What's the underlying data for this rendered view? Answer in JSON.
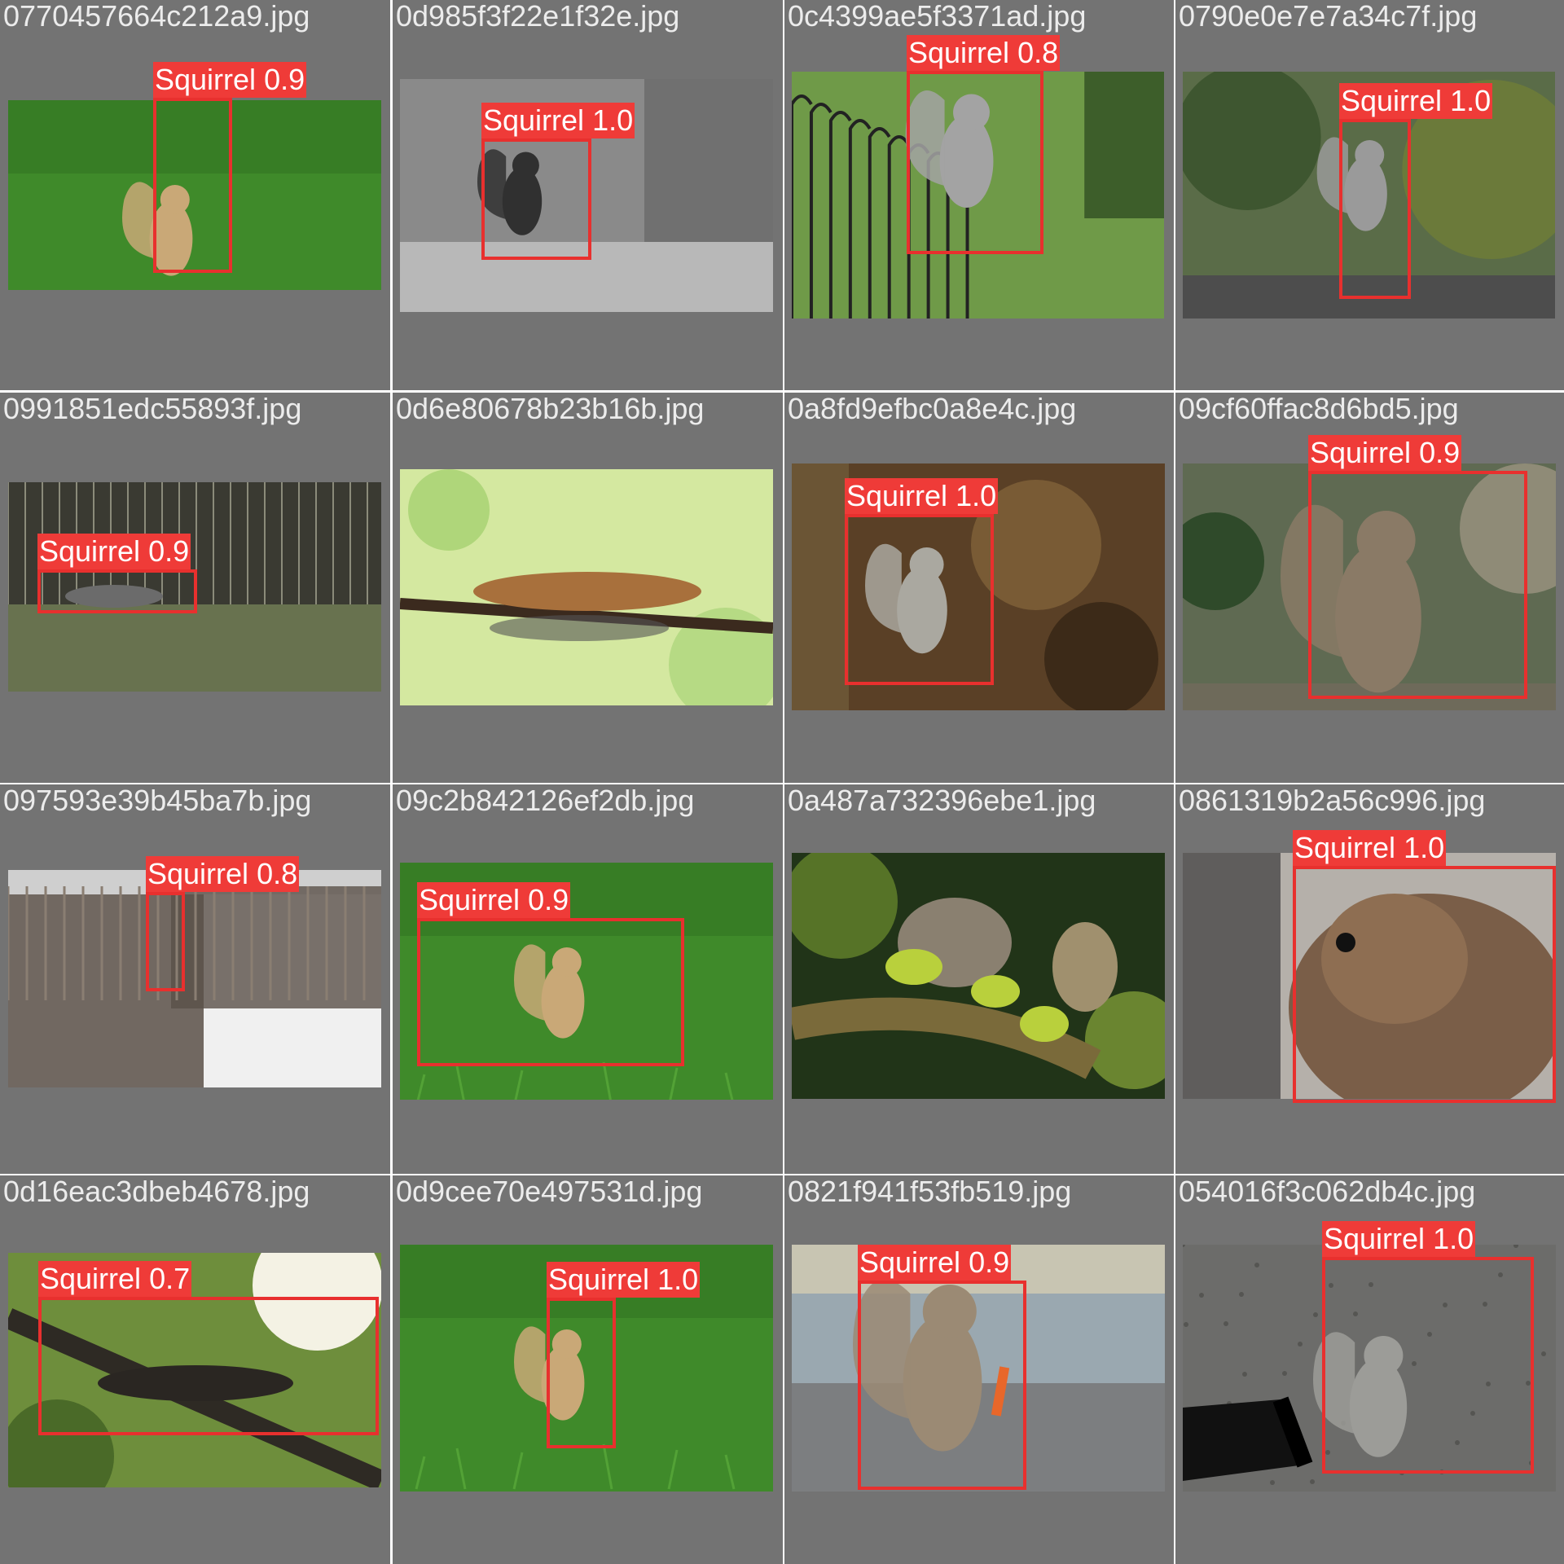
{
  "grid": {
    "background": "#737373",
    "box_color": "#e8302e",
    "label_color": "#ef3b38",
    "cells": [
      {
        "filename": "0770457664c212a9.jpg",
        "scene": "grass",
        "detections": [
          {
            "label": "Squirrel",
            "score": "0.9"
          }
        ]
      },
      {
        "filename": "0d985f3f22e1f32e.jpg",
        "scene": "grayscale",
        "detections": [
          {
            "label": "Squirrel",
            "score": "1.0"
          }
        ]
      },
      {
        "filename": "0c4399ae5f3371ad.jpg",
        "scene": "fence",
        "detections": [
          {
            "label": "Squirrel",
            "score": "0.8"
          }
        ]
      },
      {
        "filename": "0790e0e7e7a34c7f.jpg",
        "scene": "shrub",
        "detections": [
          {
            "label": "Squirrel",
            "score": "1.0"
          }
        ]
      },
      {
        "filename": "0991851edc55893f.jpg",
        "scene": "fence-yard",
        "detections": [
          {
            "label": "Squirrel",
            "score": "0.9"
          }
        ]
      },
      {
        "filename": "0d6e80678b23b16b.jpg",
        "scene": "branch-green",
        "detections": []
      },
      {
        "filename": "0a8fd9efbc0a8e4c.jpg",
        "scene": "forest-floor",
        "detections": [
          {
            "label": "Squirrel",
            "score": "1.0"
          }
        ]
      },
      {
        "filename": "09cf60ffac8d6bd5.jpg",
        "scene": "bokeh",
        "detections": [
          {
            "label": "Squirrel",
            "score": "0.9"
          }
        ]
      },
      {
        "filename": "097593e39b45ba7b.jpg",
        "scene": "bench-snow",
        "detections": [
          {
            "label": "Squirrel",
            "score": "0.8"
          }
        ]
      },
      {
        "filename": "09c2b842126ef2db.jpg",
        "scene": "grass",
        "detections": [
          {
            "label": "Squirrel",
            "score": "0.9"
          }
        ]
      },
      {
        "filename": "0a487a732396ebe1.jpg",
        "scene": "leaves",
        "detections": []
      },
      {
        "filename": "0861319b2a56c996.jpg",
        "scene": "closeup",
        "detections": [
          {
            "label": "Squirrel",
            "score": "1.0"
          }
        ]
      },
      {
        "filename": "0d16eac3dbeb4678.jpg",
        "scene": "tree",
        "detections": [
          {
            "label": "Squirrel",
            "score": "0.7"
          }
        ]
      },
      {
        "filename": "0d9cee70e497531d.jpg",
        "scene": "grass",
        "detections": [
          {
            "label": "Squirrel",
            "score": "1.0"
          }
        ]
      },
      {
        "filename": "0821f941f53fb519.jpg",
        "scene": "sunlit",
        "detections": [
          {
            "label": "Squirrel",
            "score": "0.9"
          }
        ]
      },
      {
        "filename": "054016f3c062db4c.jpg",
        "scene": "asphalt",
        "detections": [
          {
            "label": "Squirrel",
            "score": "1.0"
          }
        ]
      }
    ]
  }
}
